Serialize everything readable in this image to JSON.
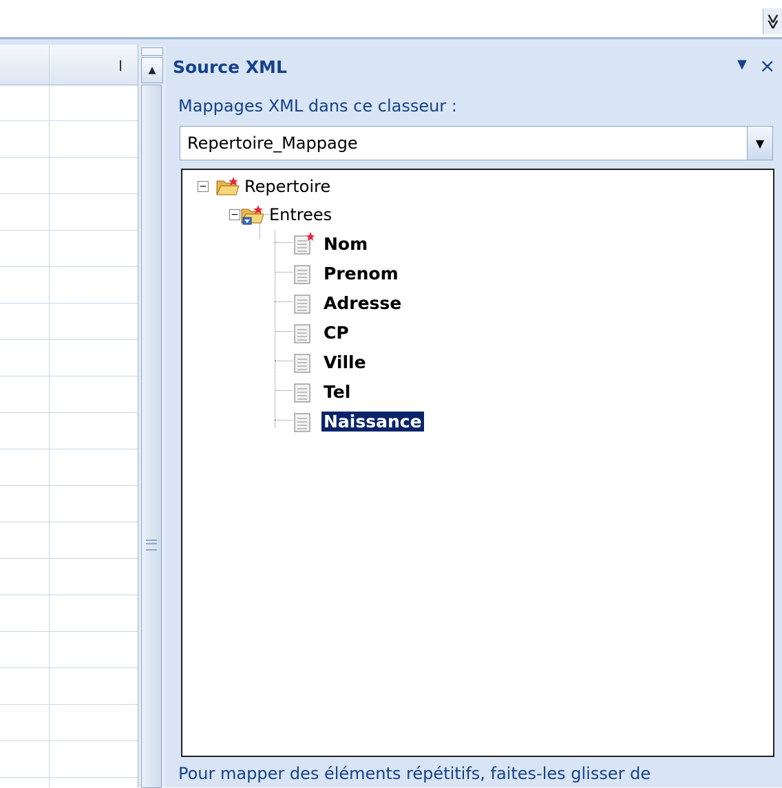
{
  "toolbar": {
    "overflow_icon": "chevron-double-down-icon",
    "overflow_glyph": "≫"
  },
  "sheet": {
    "column_header_label": "I"
  },
  "scrollbar": {
    "up_glyph": "▲"
  },
  "pane": {
    "title": "Source XML",
    "menu_glyph": "▼",
    "close_glyph": "×",
    "maps_label": "Mappages XML dans ce classeur :",
    "map_selected": "Repertoire_Mappage",
    "dropdown_glyph": "▼",
    "footer_text": "Pour mapper des éléments répétitifs, faites-les glisser de"
  },
  "tree": {
    "root": {
      "label": "Repertoire",
      "expander": "−",
      "icon": "folder-root-icon"
    },
    "child": {
      "label": "Entrees",
      "expander": "−",
      "icon": "folder-repeating-icon"
    },
    "leaves": [
      {
        "label": "Nom",
        "icon": "document-required-icon",
        "selected": false
      },
      {
        "label": "Prenom",
        "icon": "document-icon",
        "selected": false
      },
      {
        "label": "Adresse",
        "icon": "document-icon",
        "selected": false
      },
      {
        "label": "CP",
        "icon": "document-icon",
        "selected": false
      },
      {
        "label": "Ville",
        "icon": "document-icon",
        "selected": false
      },
      {
        "label": "Tel",
        "icon": "document-icon",
        "selected": false
      },
      {
        "label": "Naissance",
        "icon": "document-icon",
        "selected": true
      }
    ]
  },
  "colors": {
    "pane_background": "#d9e5f4",
    "title_text": "#15428b",
    "selection": "#0a246a"
  }
}
